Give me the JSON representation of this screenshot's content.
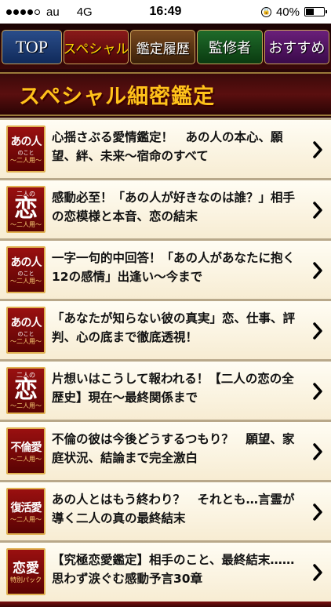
{
  "status_bar": {
    "carrier": "au",
    "network": "4G",
    "time": "16:49",
    "battery": "40%",
    "signal_dots_filled": 4,
    "signal_dots_total": 5
  },
  "nav": {
    "tabs": [
      {
        "label": "TOP"
      },
      {
        "label": "スペシャル"
      },
      {
        "label": "鑑定履歴"
      },
      {
        "label": "監修者"
      },
      {
        "label": "おすすめ"
      }
    ]
  },
  "section": {
    "title": "スペシャル細密鑑定"
  },
  "items": [
    {
      "badge": {
        "top": "",
        "main": "あの人",
        "sub": "のこと",
        "sub2": "〜二人用〜"
      },
      "text": "心揺さぶる愛情鑑定！　あの人の本心、願望、絆、未来〜宿命のすべて"
    },
    {
      "badge": {
        "top": "二人の",
        "main": "恋",
        "sub": "",
        "sub2": "〜二人用〜"
      },
      "text": "感動必至！「あの人が好きなのは誰？」相手の恋模様と本音、恋の結末"
    },
    {
      "badge": {
        "top": "",
        "main": "あの人",
        "sub": "のこと",
        "sub2": "〜二人用〜"
      },
      "text": "一字一句的中回答！「あの人があなたに抱く12の感情」出逢い〜今まで"
    },
    {
      "badge": {
        "top": "",
        "main": "あの人",
        "sub": "のこと",
        "sub2": "〜二人用〜"
      },
      "text": "「あなたが知らない彼の真実」恋、仕事、評判、心の底まで徹底透視！"
    },
    {
      "badge": {
        "top": "二人の",
        "main": "恋",
        "sub": "",
        "sub2": "〜二人用〜"
      },
      "text": "片想いはこうして報われる！【二人の恋の全歴史】現在〜最終関係まで"
    },
    {
      "badge": {
        "top": "",
        "main": "不倫愛",
        "sub": "",
        "sub2": "〜二人用〜"
      },
      "text": "不倫の彼は今後どうするつもり？　願望、家庭状況、結論まで完全激白"
    },
    {
      "badge": {
        "top": "",
        "main": "復活愛",
        "sub": "",
        "sub2": "〜二人用〜"
      },
      "text": "あの人とはもう終わり？　それとも…言霊が導く二人の真の最終結末"
    },
    {
      "badge": {
        "top": "",
        "main": "恋愛",
        "sub": "特別パック",
        "sub2": ""
      },
      "text": "【究極恋愛鑑定】相手のこと、最終結末……思わず涙ぐむ感動予言30章"
    }
  ]
}
